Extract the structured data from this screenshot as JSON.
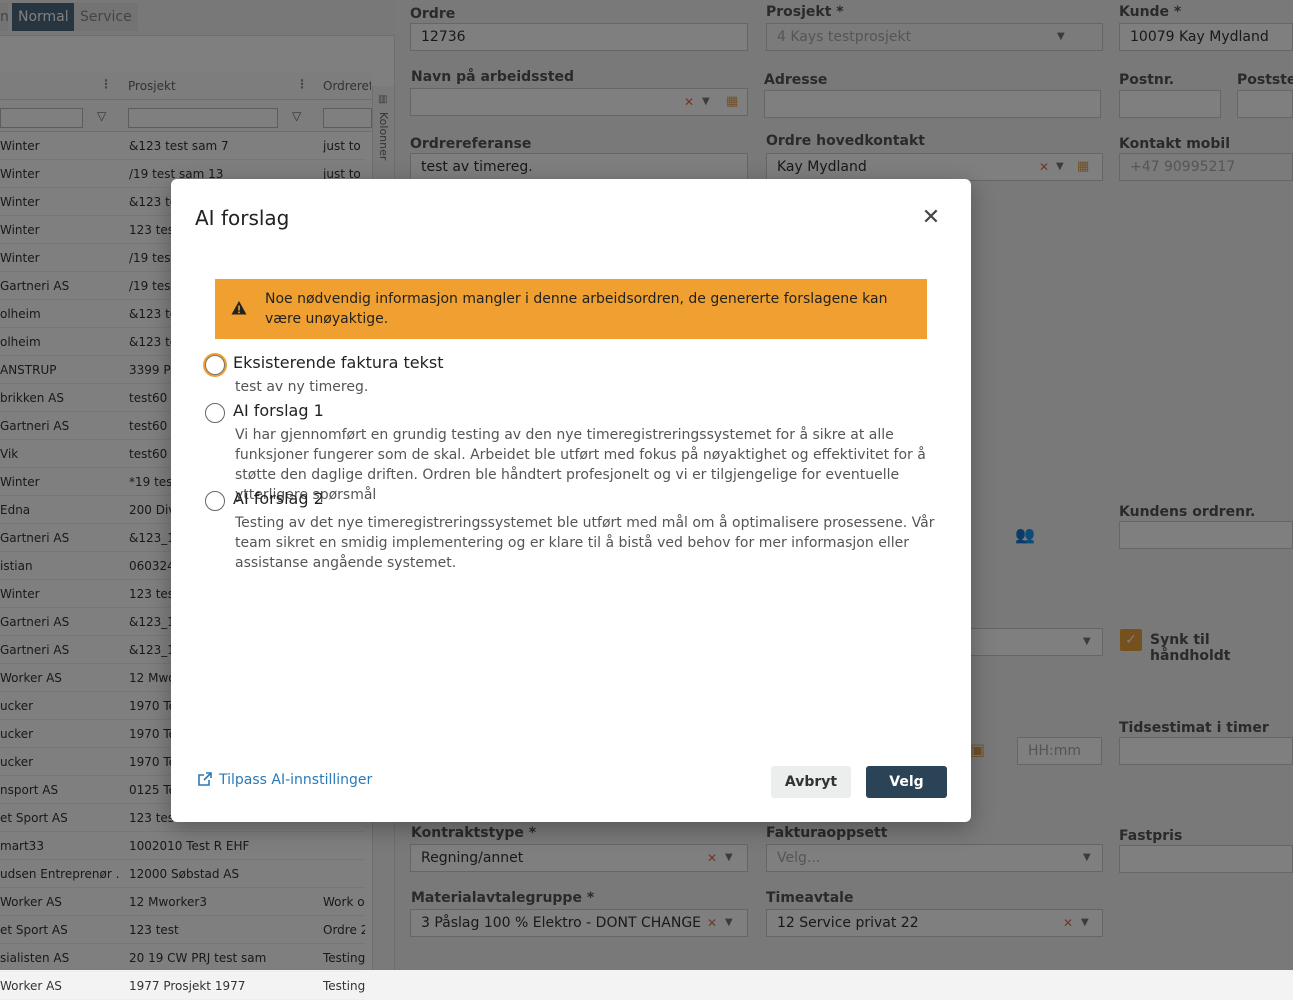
{
  "tabs": [
    {
      "label": "n"
    },
    {
      "label": "Normal"
    },
    {
      "label": "Service"
    }
  ],
  "grid": {
    "headers": [
      "Prosjekt",
      "Ordrerefe"
    ],
    "rows": [
      {
        "c1": "Winter",
        "c2": "&123 test sam 7",
        "c3": "just to"
      },
      {
        "c1": "Winter",
        "c2": "/19 test sam 13",
        "c3": "just to"
      },
      {
        "c1": "Winter",
        "c2": "&123 te",
        "c3": ""
      },
      {
        "c1": "Winter",
        "c2": "123 test",
        "c3": ""
      },
      {
        "c1": "Winter",
        "c2": "/19 test",
        "c3": ""
      },
      {
        "c1": "Gartneri AS",
        "c2": "/19 test",
        "c3": ""
      },
      {
        "c1": "olheim",
        "c2": "&123 te",
        "c3": ""
      },
      {
        "c1": "olheim",
        "c2": "&123 te",
        "c3": ""
      },
      {
        "c1": "ANSTRUP",
        "c2": "3399 Pr",
        "c3": ""
      },
      {
        "c1": "brikken AS",
        "c2": "test60",
        "c3": ""
      },
      {
        "c1": "Gartneri AS",
        "c2": "test60",
        "c3": ""
      },
      {
        "c1": "Vik",
        "c2": "test60",
        "c3": ""
      },
      {
        "c1": "Winter",
        "c2": "*19 test",
        "c3": ""
      },
      {
        "c1": "Edna",
        "c2": "200 Dive",
        "c3": ""
      },
      {
        "c1": "Gartneri AS",
        "c2": "&123_1",
        "c3": ""
      },
      {
        "c1": "istian",
        "c2": "060324",
        "c3": ""
      },
      {
        "c1": "Winter",
        "c2": "123 test",
        "c3": ""
      },
      {
        "c1": "Gartneri AS",
        "c2": "&123_1",
        "c3": ""
      },
      {
        "c1": "Gartneri AS",
        "c2": "&123_1",
        "c3": ""
      },
      {
        "c1": "Worker AS",
        "c2": "12 Mwo",
        "c3": ""
      },
      {
        "c1": "ucker",
        "c2": "1970 Te",
        "c3": ""
      },
      {
        "c1": "ucker",
        "c2": "1970 Te",
        "c3": ""
      },
      {
        "c1": "ucker",
        "c2": "1970 Te",
        "c3": ""
      },
      {
        "c1": "nsport AS",
        "c2": "0125 Te",
        "c3": ""
      },
      {
        "c1": "et Sport AS",
        "c2": "123 test",
        "c3": ""
      },
      {
        "c1": "mart33",
        "c2": "1002010 Test R EHF",
        "c3": ""
      },
      {
        "c1": "udsen Entreprenør ...",
        "c2": "12000 Søbstad AS",
        "c3": ""
      },
      {
        "c1": "Worker AS",
        "c2": "12 Mworker3",
        "c3": "Work o"
      },
      {
        "c1": "et Sport AS",
        "c2": "123 test",
        "c3": "Ordre 2"
      },
      {
        "c1": "sialisten AS",
        "c2": "20 19 CW PRJ test sam",
        "c3": "Testing"
      },
      {
        "c1": "Worker AS",
        "c2": "1977 Prosjekt 1977",
        "c3": "Testing"
      }
    ],
    "columns_button_label": "Kolonner"
  },
  "form": {
    "ordre_label": "Ordre",
    "ordre_value": "12736",
    "prosjekt_label": "Prosjekt *",
    "prosjekt_value": "4 Kays testprosjekt",
    "kunde_label": "Kunde *",
    "kunde_value": "10079 Kay Mydland",
    "arbeidssted_label": "Navn på arbeidssted",
    "adresse_label": "Adresse",
    "postnr_label": "Postnr.",
    "poststed_label": "Poststed",
    "ordrereferanse_label": "Ordrereferanse",
    "ordrereferanse_value": "test av timereg.",
    "hovedkontakt_label": "Ordre hovedkontakt",
    "hovedkontakt_value": "Kay Mydland",
    "kontakt_mobil_label": "Kontakt mobil",
    "kontakt_mobil_value": "+47 90995217",
    "kundens_ordrenr_label": "Kundens ordrenr.",
    "synk_label": "Synk til håndholdt",
    "tidsestimat_label": "Tidsestimat i timer",
    "time_placeholder": "HH:mm",
    "kontraktstype_label": "Kontraktstype *",
    "kontraktstype_value": "Regning/annet",
    "fakturaoppsett_label": "Fakturaoppsett",
    "fakturaoppsett_placeholder": "Velg...",
    "fastpris_label": "Fastpris",
    "materialavtale_label": "Materialavtalegruppe *",
    "materialavtale_value": "3 Påslag 100 % Elektro - DONT CHANGE",
    "timeavtale_label": "Timeavtale",
    "timeavtale_value": "12 Service privat 22"
  },
  "modal": {
    "title": "AI forslag",
    "warning": "Noe nødvendig informasjon mangler i denne arbeidsordren, de genererte forslagene kan være unøyaktige.",
    "options": [
      {
        "title": "Eksisterende faktura tekst",
        "desc": "test av ny timereg."
      },
      {
        "title": "AI forslag 1",
        "desc": "Vi har gjennomført en grundig testing av den nye timeregistreringssystemet for å sikre at alle funksjoner fungerer som de skal. Arbeidet ble utført med fokus på nøyaktighet og effektivitet for å støtte den daglige driften. Ordren ble håndtert profesjonelt og vi er tilgjengelige for eventuelle ytterligere spørsmål"
      },
      {
        "title": "AI forslag 2",
        "desc": "Testing av det nye timeregistreringssystemet ble utført med mål om å optimalisere prosessene. Vår team sikret en smidig implementering og er klare til å bistå ved behov for mer informasjon eller assistanse angående systemet."
      }
    ],
    "settings_link": "Tilpass AI-innstillinger",
    "cancel_label": "Avbryt",
    "choose_label": "Velg"
  },
  "colors": {
    "warning_bg": "#f0a030",
    "primary_button": "#2b4356",
    "link": "#2a7ab8",
    "active_tab": "#4d6a7f"
  }
}
